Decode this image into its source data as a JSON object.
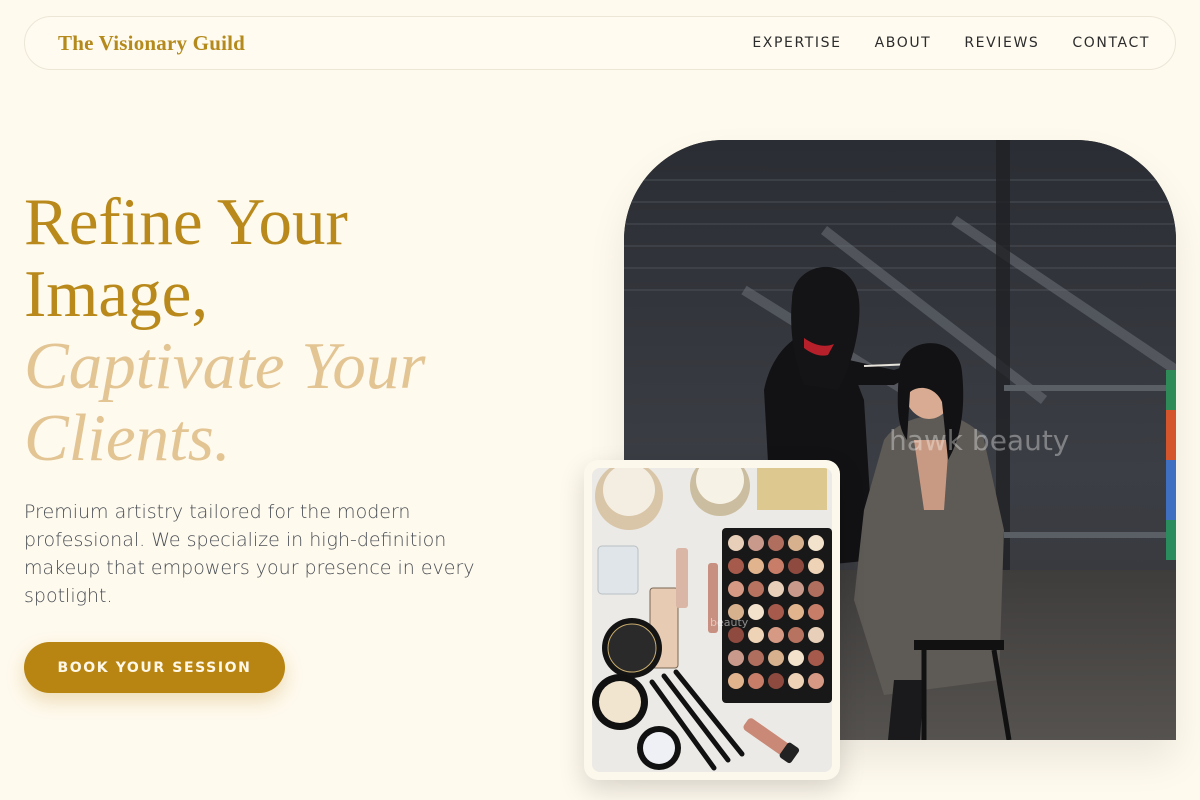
{
  "brand": {
    "name": "The Visionary Guild"
  },
  "nav": {
    "items": [
      {
        "label": "EXPERTISE"
      },
      {
        "label": "ABOUT"
      },
      {
        "label": "REVIEWS"
      },
      {
        "label": "CONTACT"
      }
    ]
  },
  "hero": {
    "headline_line1": "Refine Your",
    "headline_line2": "Image,",
    "headline_line3": "Captivate Your",
    "headline_line4": "Clients.",
    "lead": "Premium artistry tailored for the modern professional. We specialize in high-definition makeup that empowers your presence in every spotlight.",
    "cta_label": "BOOK YOUR SESSION"
  },
  "images": {
    "main_watermark": "hawk beauty",
    "inset_watermark": "beauty"
  },
  "colors": {
    "background": "#fffaee",
    "brand_gold": "#b58a1c",
    "headline_soft": "#e3c594",
    "cta_bg": "#b98512"
  }
}
